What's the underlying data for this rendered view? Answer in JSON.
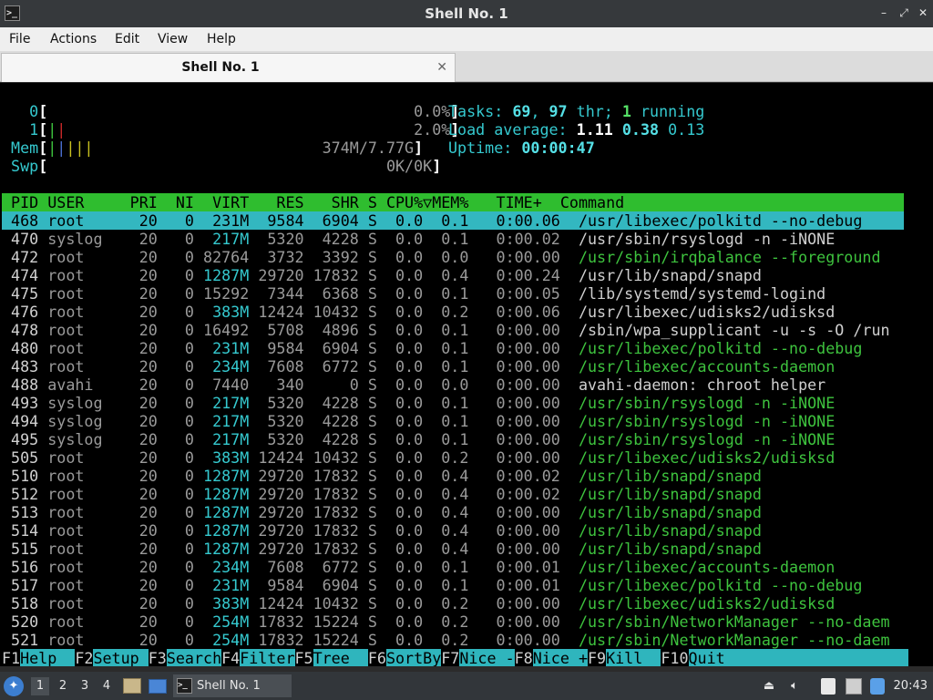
{
  "window": {
    "title": "Shell No. 1",
    "icon_glyph": ">_",
    "buttons": [
      "–",
      "⤢",
      "✕"
    ]
  },
  "menu": [
    "File",
    "Actions",
    "Edit",
    "View",
    "Help"
  ],
  "tab": {
    "label": "Shell No. 1",
    "close": "✕"
  },
  "htop": {
    "meters": {
      "cpu0": {
        "label": "0",
        "value": "0.0%"
      },
      "cpu1": {
        "label": "1",
        "value": "2.0%"
      },
      "mem": {
        "label": "Mem",
        "value": "374M/7.77G"
      },
      "swp": {
        "label": "Swp",
        "value": "0K/0K"
      }
    },
    "summary": {
      "tasks_label": "Tasks:",
      "tasks": "69",
      "thr": "97",
      "thr_label": "thr;",
      "running": "1",
      "running_label": "running",
      "load_label": "Load average:",
      "load1": "1.11",
      "load5": "0.38",
      "load15": "0.13",
      "uptime_label": "Uptime:",
      "uptime": "00:00:47"
    },
    "header": " PID USER     PRI  NI  VIRT   RES   SHR S CPU%▽MEM%   TIME+  Command",
    "processes": [
      {
        "pid": "468",
        "user": "root",
        "pri": "20",
        "ni": "0",
        "virt": "231M",
        "res": "9584",
        "shr": "6904",
        "s": "S",
        "cpu": "0.0",
        "mem": "0.1",
        "time": "0:00.06",
        "cmd": "/usr/libexec/polkitd --no-debug",
        "thread": false,
        "selected": true
      },
      {
        "pid": "470",
        "user": "syslog",
        "pri": "20",
        "ni": "0",
        "virt": "217M",
        "res": "5320",
        "shr": "4228",
        "s": "S",
        "cpu": "0.0",
        "mem": "0.1",
        "time": "0:00.02",
        "cmd": "/usr/sbin/rsyslogd -n -iNONE",
        "thread": false
      },
      {
        "pid": "472",
        "user": "root",
        "pri": "20",
        "ni": "0",
        "virt": "82764",
        "res": "3732",
        "shr": "3392",
        "s": "S",
        "cpu": "0.0",
        "mem": "0.0",
        "time": "0:00.00",
        "cmd": "/usr/sbin/irqbalance --foreground",
        "thread": true
      },
      {
        "pid": "474",
        "user": "root",
        "pri": "20",
        "ni": "0",
        "virt": "1287M",
        "res": "29720",
        "shr": "17832",
        "s": "S",
        "cpu": "0.0",
        "mem": "0.4",
        "time": "0:00.24",
        "cmd": "/usr/lib/snapd/snapd",
        "thread": false
      },
      {
        "pid": "475",
        "user": "root",
        "pri": "20",
        "ni": "0",
        "virt": "15292",
        "res": "7344",
        "shr": "6368",
        "s": "S",
        "cpu": "0.0",
        "mem": "0.1",
        "time": "0:00.05",
        "cmd": "/lib/systemd/systemd-logind",
        "thread": false
      },
      {
        "pid": "476",
        "user": "root",
        "pri": "20",
        "ni": "0",
        "virt": "383M",
        "res": "12424",
        "shr": "10432",
        "s": "S",
        "cpu": "0.0",
        "mem": "0.2",
        "time": "0:00.06",
        "cmd": "/usr/libexec/udisks2/udisksd",
        "thread": false
      },
      {
        "pid": "478",
        "user": "root",
        "pri": "20",
        "ni": "0",
        "virt": "16492",
        "res": "5708",
        "shr": "4896",
        "s": "S",
        "cpu": "0.0",
        "mem": "0.1",
        "time": "0:00.00",
        "cmd": "/sbin/wpa_supplicant -u -s -O /run",
        "thread": false
      },
      {
        "pid": "480",
        "user": "root",
        "pri": "20",
        "ni": "0",
        "virt": "231M",
        "res": "9584",
        "shr": "6904",
        "s": "S",
        "cpu": "0.0",
        "mem": "0.1",
        "time": "0:00.00",
        "cmd": "/usr/libexec/polkitd --no-debug",
        "thread": true
      },
      {
        "pid": "483",
        "user": "root",
        "pri": "20",
        "ni": "0",
        "virt": "234M",
        "res": "7608",
        "shr": "6772",
        "s": "S",
        "cpu": "0.0",
        "mem": "0.1",
        "time": "0:00.00",
        "cmd": "/usr/libexec/accounts-daemon",
        "thread": true
      },
      {
        "pid": "488",
        "user": "avahi",
        "pri": "20",
        "ni": "0",
        "virt": "7440",
        "res": "340",
        "shr": "0",
        "s": "S",
        "cpu": "0.0",
        "mem": "0.0",
        "time": "0:00.00",
        "cmd": "avahi-daemon: chroot helper",
        "thread": false
      },
      {
        "pid": "493",
        "user": "syslog",
        "pri": "20",
        "ni": "0",
        "virt": "217M",
        "res": "5320",
        "shr": "4228",
        "s": "S",
        "cpu": "0.0",
        "mem": "0.1",
        "time": "0:00.00",
        "cmd": "/usr/sbin/rsyslogd -n -iNONE",
        "thread": true
      },
      {
        "pid": "494",
        "user": "syslog",
        "pri": "20",
        "ni": "0",
        "virt": "217M",
        "res": "5320",
        "shr": "4228",
        "s": "S",
        "cpu": "0.0",
        "mem": "0.1",
        "time": "0:00.00",
        "cmd": "/usr/sbin/rsyslogd -n -iNONE",
        "thread": true
      },
      {
        "pid": "495",
        "user": "syslog",
        "pri": "20",
        "ni": "0",
        "virt": "217M",
        "res": "5320",
        "shr": "4228",
        "s": "S",
        "cpu": "0.0",
        "mem": "0.1",
        "time": "0:00.00",
        "cmd": "/usr/sbin/rsyslogd -n -iNONE",
        "thread": true
      },
      {
        "pid": "505",
        "user": "root",
        "pri": "20",
        "ni": "0",
        "virt": "383M",
        "res": "12424",
        "shr": "10432",
        "s": "S",
        "cpu": "0.0",
        "mem": "0.2",
        "time": "0:00.00",
        "cmd": "/usr/libexec/udisks2/udisksd",
        "thread": true
      },
      {
        "pid": "510",
        "user": "root",
        "pri": "20",
        "ni": "0",
        "virt": "1287M",
        "res": "29720",
        "shr": "17832",
        "s": "S",
        "cpu": "0.0",
        "mem": "0.4",
        "time": "0:00.02",
        "cmd": "/usr/lib/snapd/snapd",
        "thread": true
      },
      {
        "pid": "512",
        "user": "root",
        "pri": "20",
        "ni": "0",
        "virt": "1287M",
        "res": "29720",
        "shr": "17832",
        "s": "S",
        "cpu": "0.0",
        "mem": "0.4",
        "time": "0:00.02",
        "cmd": "/usr/lib/snapd/snapd",
        "thread": true
      },
      {
        "pid": "513",
        "user": "root",
        "pri": "20",
        "ni": "0",
        "virt": "1287M",
        "res": "29720",
        "shr": "17832",
        "s": "S",
        "cpu": "0.0",
        "mem": "0.4",
        "time": "0:00.00",
        "cmd": "/usr/lib/snapd/snapd",
        "thread": true
      },
      {
        "pid": "514",
        "user": "root",
        "pri": "20",
        "ni": "0",
        "virt": "1287M",
        "res": "29720",
        "shr": "17832",
        "s": "S",
        "cpu": "0.0",
        "mem": "0.4",
        "time": "0:00.00",
        "cmd": "/usr/lib/snapd/snapd",
        "thread": true
      },
      {
        "pid": "515",
        "user": "root",
        "pri": "20",
        "ni": "0",
        "virt": "1287M",
        "res": "29720",
        "shr": "17832",
        "s": "S",
        "cpu": "0.0",
        "mem": "0.4",
        "time": "0:00.00",
        "cmd": "/usr/lib/snapd/snapd",
        "thread": true
      },
      {
        "pid": "516",
        "user": "root",
        "pri": "20",
        "ni": "0",
        "virt": "234M",
        "res": "7608",
        "shr": "6772",
        "s": "S",
        "cpu": "0.0",
        "mem": "0.1",
        "time": "0:00.01",
        "cmd": "/usr/libexec/accounts-daemon",
        "thread": true
      },
      {
        "pid": "517",
        "user": "root",
        "pri": "20",
        "ni": "0",
        "virt": "231M",
        "res": "9584",
        "shr": "6904",
        "s": "S",
        "cpu": "0.0",
        "mem": "0.1",
        "time": "0:00.01",
        "cmd": "/usr/libexec/polkitd --no-debug",
        "thread": true
      },
      {
        "pid": "518",
        "user": "root",
        "pri": "20",
        "ni": "0",
        "virt": "383M",
        "res": "12424",
        "shr": "10432",
        "s": "S",
        "cpu": "0.0",
        "mem": "0.2",
        "time": "0:00.00",
        "cmd": "/usr/libexec/udisks2/udisksd",
        "thread": true
      },
      {
        "pid": "520",
        "user": "root",
        "pri": "20",
        "ni": "0",
        "virt": "254M",
        "res": "17832",
        "shr": "15224",
        "s": "S",
        "cpu": "0.0",
        "mem": "0.2",
        "time": "0:00.00",
        "cmd": "/usr/sbin/NetworkManager --no-daem",
        "thread": true
      },
      {
        "pid": "521",
        "user": "root",
        "pri": "20",
        "ni": "0",
        "virt": "254M",
        "res": "17832",
        "shr": "15224",
        "s": "S",
        "cpu": "0.0",
        "mem": "0.2",
        "time": "0:00.00",
        "cmd": "/usr/sbin/NetworkManager --no-daem",
        "thread": true
      }
    ],
    "fkeys": [
      {
        "key": "F1",
        "label": "Help  "
      },
      {
        "key": "F2",
        "label": "Setup "
      },
      {
        "key": "F3",
        "label": "Search"
      },
      {
        "key": "F4",
        "label": "Filter"
      },
      {
        "key": "F5",
        "label": "Tree  "
      },
      {
        "key": "F6",
        "label": "SortBy"
      },
      {
        "key": "F7",
        "label": "Nice -"
      },
      {
        "key": "F8",
        "label": "Nice +"
      },
      {
        "key": "F9",
        "label": "Kill  "
      },
      {
        "key": "F10",
        "label": "Quit"
      }
    ]
  },
  "taskbar": {
    "workspaces": [
      "1",
      "2",
      "3",
      "4"
    ],
    "active_workspace": "1",
    "task_label": "Shell No. 1",
    "clock": "20:43",
    "tray": [
      "removable-media-icon",
      "volume-icon",
      "clipboard-icon",
      "network-icon",
      "update-icon"
    ]
  },
  "colors": {
    "header_bg": "#2fbd2f",
    "selected_bg": "#33b7c0",
    "thread_fg": "#3ec33e",
    "cyan": "#35c9cf"
  }
}
